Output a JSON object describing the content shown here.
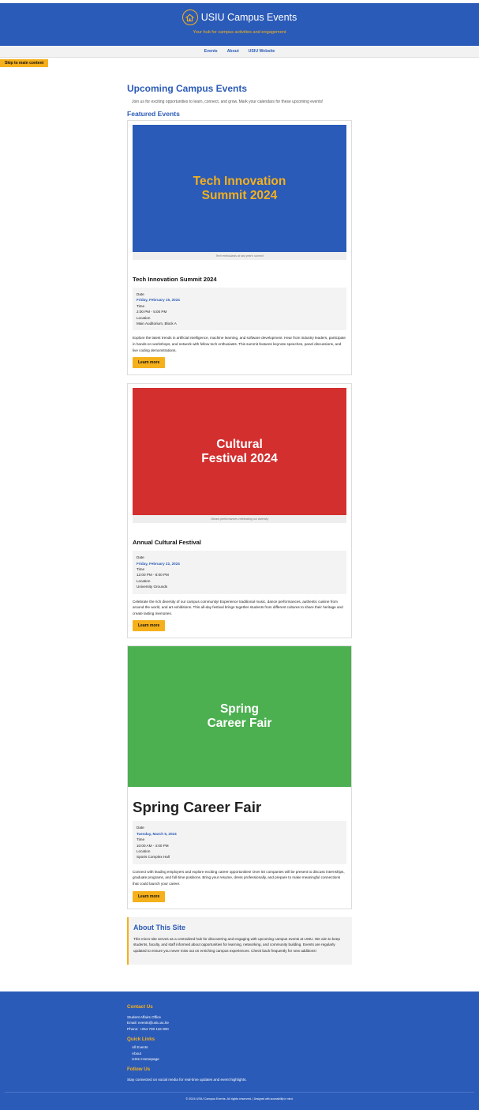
{
  "header": {
    "title": "USIU Campus Events",
    "tagline": "Your hub for campus activities and engagement"
  },
  "nav": [
    "Events",
    "About",
    "USIU Website"
  ],
  "skip_link": "Skip to main content",
  "main": {
    "heading": "Upcoming Campus Events",
    "intro": "Join us for exciting opportunities to learn, connect, and grow. Mark your calendars for these upcoming events!",
    "featured_heading": "Featured Events"
  },
  "events": [
    {
      "banner_line1": "Tech Innovation",
      "banner_line2": "Summit 2024",
      "banner_bg": "#2b5bb8",
      "banner_fg": "#f5b01b",
      "caption": "Tech enthusiasts at last year's summit",
      "title": "Tech Innovation Summit 2024",
      "date_label": "Date",
      "date": "Friday, February 15, 2024",
      "time_label": "Time",
      "time": "2:00 PM - 5:00 PM",
      "location_label": "Location",
      "location": "Main Auditorium, Block A",
      "description": "Explore the latest trends in artificial intelligence, machine learning, and software development. Hear from industry leaders, participate in hands-on workshops, and network with fellow tech enthusiasts. This summit features keynote speeches, panel discussions, and live coding demonstrations.",
      "button": "Learn more"
    },
    {
      "banner_line1": "Cultural",
      "banner_line2": "Festival 2024",
      "banner_bg": "#d32f2f",
      "banner_fg": "#ffffff",
      "caption": "Vibrant performances celebrating our diversity",
      "title": "Annual Cultural Festival",
      "date_label": "Date",
      "date": "Friday, February 22, 2024",
      "time_label": "Time",
      "time": "12:00 PM - 8:00 PM",
      "location_label": "Location",
      "location": "University Grounds",
      "description": "Celebrate the rich diversity of our campus community! Experience traditional music, dance performances, authentic cuisine from around the world, and art exhibitions. This all-day festival brings together students from different cultures to share their heritage and create lasting memories.",
      "button": "Learn more"
    },
    {
      "banner_line1": "Spring",
      "banner_line2": "Career Fair",
      "banner_bg": "#4caf50",
      "banner_fg": "#ffffff",
      "title": "Spring Career Fair",
      "date_label": "Date",
      "date": "Tuesday, March 5, 2024",
      "time_label": "Time",
      "time": "10:00 AM - 4:00 PM",
      "location_label": "Location",
      "location": "Sports Complex Hall",
      "description": "Connect with leading employers and explore exciting career opportunities! Over 50 companies will be present to discuss internships, graduate programs, and full-time positions. Bring your resume, dress professionally, and prepare to make meaningful connections that could launch your career.",
      "button": "Learn more"
    }
  ],
  "about": {
    "heading": "About This Site",
    "text": "This micro-site serves as a centralized hub for discovering and engaging with upcoming campus events at USIU. We aim to keep students, faculty, and staff informed about opportunities for learning, networking, and community building. Events are regularly updated to ensure you never miss out on enriching campus experiences. Check back frequently for new additions!"
  },
  "footer": {
    "contact_heading": "Contact Us",
    "contact_office": "Student Affairs Office",
    "contact_email": "Email: events@usiu.ac.ke",
    "contact_phone": "Phone: +254 730 116 000",
    "links_heading": "Quick Links",
    "links": [
      "All Events",
      "About",
      "USIU Homepage"
    ],
    "follow_heading": "Follow Us",
    "follow_text": "Stay connected on social media for real-time updates and event highlights.",
    "copyright": "© 2024 USIU Campus Events. All rights reserved.",
    "designed": "| Designed with accessibility in mind."
  },
  "colors": {
    "primary": "#2b5bb8",
    "accent": "#f5b01b"
  },
  "icons": {
    "logo": "house-icon"
  }
}
